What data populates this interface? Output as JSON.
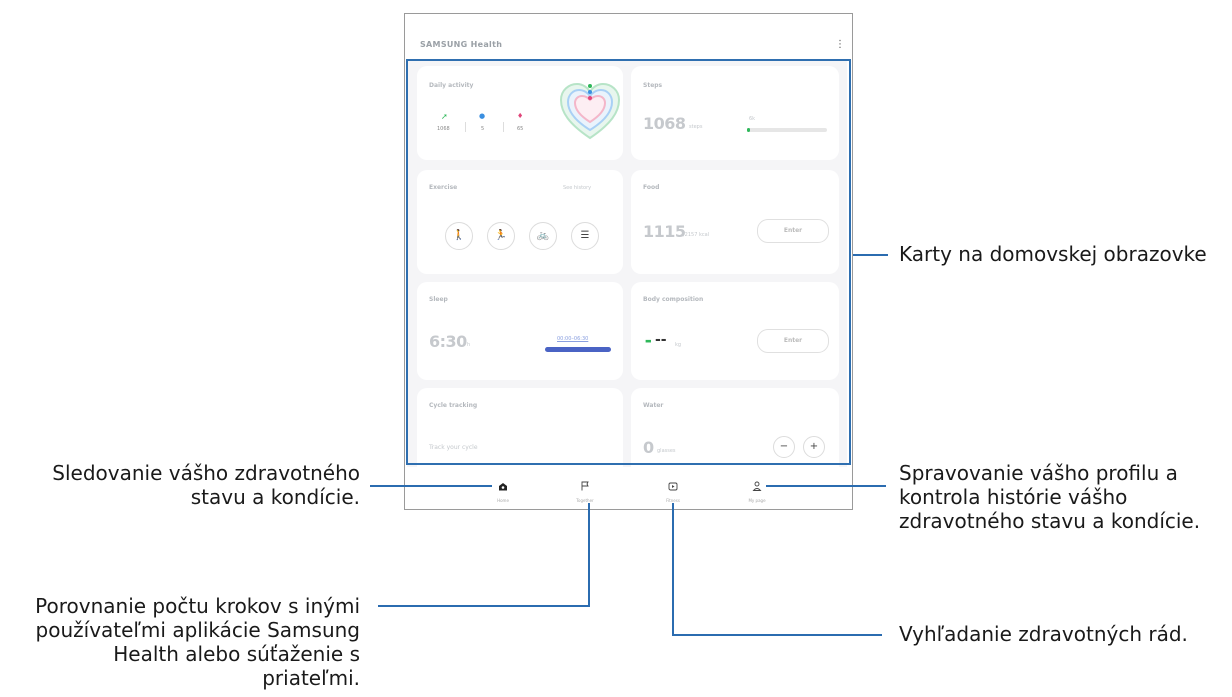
{
  "app": {
    "title": "SAMSUNG Health",
    "menu_icon": "more-vert-icon"
  },
  "cards": {
    "daily_activity": {
      "title": "Daily activity",
      "steps_value": "1068",
      "minutes_value": "5",
      "calories_value": "65"
    },
    "steps": {
      "title": "Steps",
      "value": "1068",
      "unit": "steps",
      "goal_label": "6k"
    },
    "exercise": {
      "title": "Exercise",
      "link": "See history"
    },
    "food": {
      "title": "Food",
      "value": "1115",
      "unit": "/2157 kcal",
      "button": "Enter"
    },
    "sleep": {
      "title": "Sleep",
      "value": "6:30",
      "unit": "h",
      "range": "00:00–06:30"
    },
    "body_composition": {
      "title": "Body composition",
      "value": "--",
      "unit": "kg",
      "button": "Enter"
    },
    "cycle_tracking": {
      "title": "Cycle tracking",
      "link": "Track your cycle"
    },
    "water": {
      "title": "Water",
      "value": "0",
      "unit": "glasses",
      "minus": "−",
      "plus": "+"
    }
  },
  "nav": [
    {
      "label": "Home",
      "icon": "home-icon"
    },
    {
      "label": "Together",
      "icon": "flag-icon"
    },
    {
      "label": "Fitness",
      "icon": "play-icon"
    },
    {
      "label": "My page",
      "icon": "person-icon"
    }
  ],
  "annotations": {
    "cards": "Karty na domovskej obrazovke",
    "home": [
      "Sledovanie vášho zdravotného",
      "stavu a kondície."
    ],
    "profile": [
      "Spravovanie vášho profilu a",
      "kontrola histórie vášho",
      "zdravotného stavu a kondície."
    ],
    "together": [
      "Porovnanie počtu krokov s inými",
      "používateľmi aplikácie Samsung",
      "Health alebo súťaženie s",
      "priateľmi."
    ],
    "fitness": "Vyhľadanie zdravotných rád."
  },
  "colors": {
    "accent": "#2f6fb0",
    "steps": "#2fb85a",
    "minutes": "#3b8fe0",
    "calories": "#e0467a",
    "sleep": "#4a63c4"
  }
}
